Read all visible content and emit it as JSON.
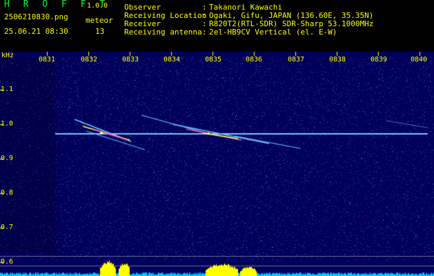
{
  "header": {
    "app_title": "H R O F F T",
    "app_version": "1.0.0",
    "file_name": "2506210830.png",
    "date_time": "25.06.21 08:30",
    "count_label": "meteor",
    "count_value": "13",
    "info": [
      {
        "label": "Observer",
        "value": "Takanori Kawachi"
      },
      {
        "label": "Receiving Location",
        "value": "Ogaki, Gifu, JAPAN (136.60E, 35.35N)"
      },
      {
        "label": "Receiver",
        "value": "R820T2(RTL-SDR) SDR-Sharp 53.1000MHz"
      },
      {
        "label": "Receiving antenna",
        "value": "2el-HB9CV Vertical (el. E-W)"
      }
    ]
  },
  "spectrogram": {
    "y_unit": "kHz",
    "x_ticks": [
      "0831",
      "0832",
      "0833",
      "0834",
      "0835",
      "0836",
      "0837",
      "0838",
      "0839",
      "0840"
    ],
    "y_ticks": [
      "1.1",
      "1.0",
      "0.9",
      "0.8",
      "0.7",
      "0.6"
    ],
    "colors": {
      "background": "#00005a",
      "noise": "#3c46c8",
      "signal_line": "#64c8ff",
      "echo_hot": "#ff50b4",
      "echo_warm": "#ffff64",
      "level_bar": "#ffff00",
      "level_baseline": "#00c8ff"
    }
  }
}
